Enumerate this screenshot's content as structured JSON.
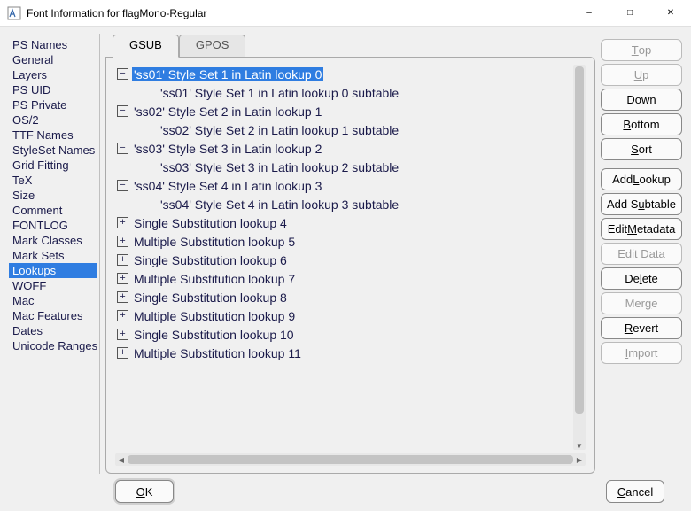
{
  "window": {
    "title": "Font Information for flagMono-Regular"
  },
  "sidebar": {
    "items": [
      {
        "label": "PS Names",
        "selected": false
      },
      {
        "label": "General",
        "selected": false
      },
      {
        "label": "Layers",
        "selected": false
      },
      {
        "label": "PS UID",
        "selected": false
      },
      {
        "label": "PS Private",
        "selected": false
      },
      {
        "label": "OS/2",
        "selected": false
      },
      {
        "label": "TTF Names",
        "selected": false
      },
      {
        "label": "StyleSet Names",
        "selected": false
      },
      {
        "label": "Grid Fitting",
        "selected": false
      },
      {
        "label": "TeX",
        "selected": false
      },
      {
        "label": "Size",
        "selected": false
      },
      {
        "label": "Comment",
        "selected": false
      },
      {
        "label": "FONTLOG",
        "selected": false
      },
      {
        "label": "Mark Classes",
        "selected": false
      },
      {
        "label": "Mark Sets",
        "selected": false
      },
      {
        "label": "Lookups",
        "selected": true
      },
      {
        "label": "WOFF",
        "selected": false
      },
      {
        "label": "Mac",
        "selected": false
      },
      {
        "label": "Mac Features",
        "selected": false
      },
      {
        "label": "Dates",
        "selected": false
      },
      {
        "label": "Unicode Ranges",
        "selected": false
      }
    ]
  },
  "tabs": [
    {
      "label": "GSUB",
      "active": true
    },
    {
      "label": "GPOS",
      "active": false
    }
  ],
  "tree": [
    {
      "depth": 0,
      "expander": "minus",
      "text": "'ss01' Style Set 1 in Latin lookup 0",
      "selected": true
    },
    {
      "depth": 1,
      "expander": "none",
      "text": "'ss01' Style Set 1 in Latin lookup 0 subtable",
      "selected": false
    },
    {
      "depth": 0,
      "expander": "minus",
      "text": "'ss02' Style Set 2 in Latin lookup 1",
      "selected": false
    },
    {
      "depth": 1,
      "expander": "none",
      "text": "'ss02' Style Set 2 in Latin lookup 1 subtable",
      "selected": false
    },
    {
      "depth": 0,
      "expander": "minus",
      "text": "'ss03' Style Set 3 in Latin lookup 2",
      "selected": false
    },
    {
      "depth": 1,
      "expander": "none",
      "text": "'ss03' Style Set 3 in Latin lookup 2 subtable",
      "selected": false
    },
    {
      "depth": 0,
      "expander": "minus",
      "text": "'ss04' Style Set 4 in Latin lookup 3",
      "selected": false
    },
    {
      "depth": 1,
      "expander": "none",
      "text": "'ss04' Style Set 4 in Latin lookup 3 subtable",
      "selected": false
    },
    {
      "depth": 0,
      "expander": "plus",
      "text": "Single Substitution lookup 4",
      "selected": false
    },
    {
      "depth": 0,
      "expander": "plus",
      "text": "Multiple Substitution lookup 5",
      "selected": false
    },
    {
      "depth": 0,
      "expander": "plus",
      "text": "Single Substitution lookup 6",
      "selected": false
    },
    {
      "depth": 0,
      "expander": "plus",
      "text": "Multiple Substitution lookup 7",
      "selected": false
    },
    {
      "depth": 0,
      "expander": "plus",
      "text": "Single Substitution lookup 8",
      "selected": false
    },
    {
      "depth": 0,
      "expander": "plus",
      "text": "Multiple Substitution lookup 9",
      "selected": false
    },
    {
      "depth": 0,
      "expander": "plus",
      "text": "Single Substitution lookup 10",
      "selected": false
    },
    {
      "depth": 0,
      "expander": "plus",
      "text": "Multiple Substitution lookup 11",
      "selected": false
    }
  ],
  "buttons": {
    "top": {
      "pre": "",
      "u": "T",
      "post": "op",
      "disabled": true
    },
    "up": {
      "pre": "",
      "u": "U",
      "post": "p",
      "disabled": true
    },
    "down": {
      "pre": "",
      "u": "D",
      "post": "own",
      "disabled": false
    },
    "bottom": {
      "pre": "",
      "u": "B",
      "post": "ottom",
      "disabled": false
    },
    "sort": {
      "pre": "",
      "u": "S",
      "post": "ort",
      "disabled": false
    },
    "addlookup": {
      "pre": "Add ",
      "u": "L",
      "post": "ookup",
      "disabled": false
    },
    "addsubtable": {
      "pre": "Add S",
      "u": "u",
      "post": "btable",
      "disabled": false
    },
    "editmeta": {
      "pre": "Edit ",
      "u": "M",
      "post": "etadata",
      "disabled": false
    },
    "editdata": {
      "pre": "",
      "u": "E",
      "post": "dit Data",
      "disabled": true
    },
    "delete": {
      "pre": "De",
      "u": "l",
      "post": "ete",
      "disabled": false
    },
    "merge": {
      "pre": "Mer",
      "u": "g",
      "post": "e",
      "disabled": true
    },
    "revert": {
      "pre": "",
      "u": "R",
      "post": "evert",
      "disabled": false
    },
    "import": {
      "pre": "",
      "u": "I",
      "post": "mport",
      "disabled": true
    }
  },
  "footer": {
    "ok": {
      "pre": "",
      "u": "O",
      "post": "K"
    },
    "cancel": {
      "pre": "",
      "u": "C",
      "post": "ancel"
    }
  }
}
